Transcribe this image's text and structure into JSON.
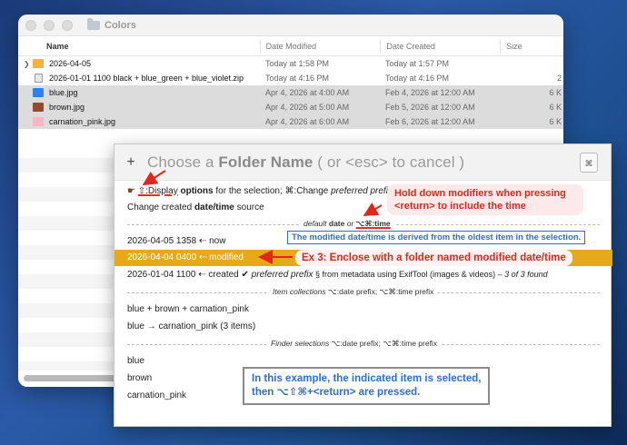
{
  "finder": {
    "title": "Colors",
    "columns": {
      "name": "Name",
      "modified": "Date Modified",
      "created": "Date Created",
      "size": "Size"
    },
    "rows": [
      {
        "name": "2026-04-05",
        "modified": "Today at 1:58 PM",
        "created": "Today at 1:57 PM",
        "size": "",
        "icon": "folder",
        "selected": false
      },
      {
        "name": "2026-01-01 1100 black + blue_green + blue_violet.zip",
        "modified": "Today at 4:16 PM",
        "created": "Today at 4:16 PM",
        "size": "2",
        "icon": "zip",
        "selected": false
      },
      {
        "name": "blue.jpg",
        "modified": "Apr 4, 2026 at 4:00 AM",
        "created": "Feb 4, 2026 at 12:00 AM",
        "size": "6 K",
        "icon": "blue",
        "selected": true
      },
      {
        "name": "brown.jpg",
        "modified": "Apr 4, 2026 at 5:00 AM",
        "created": "Feb 5, 2026 at 12:00 AM",
        "size": "6 K",
        "icon": "brown",
        "selected": true
      },
      {
        "name": "carnation_pink.jpg",
        "modified": "Apr 4, 2026 at 6:00 AM",
        "created": "Feb 6, 2026 at 12:00 AM",
        "size": "6 K",
        "icon": "pink",
        "selected": true
      }
    ]
  },
  "prompt": {
    "add_symbol": "+",
    "title_pre": "Choose a ",
    "title_bold": "Folder Name",
    "title_post": " ( or <esc> to cancel )",
    "icon_glyph": "⌘",
    "hint_modifier": "⇧:Display",
    "hint_options": "options",
    "hint_mid": " for the selection; ⌘:Change ",
    "hint_italic": "preferred prefix",
    "change_pre": "Change created ",
    "change_bold": "date/time",
    "change_post": " source",
    "sep_default": {
      "pre": "default ",
      "date": "date",
      "or": " or ",
      "time": "⌥⌘:time"
    },
    "opt_now": "2026-04-05 1358 ⇠ now",
    "opt_modified": "2026-04-04 0400 ⇠ modified",
    "opt_created_pre": "2026-01-04 1100 ⇠ created ",
    "opt_created_check": "✔",
    "opt_created_italic": " preferred prefix",
    "opt_created_post": " § from metadata using ExifTool (images & videos) – ",
    "opt_created_count": "3 of 3 found",
    "sep_items": {
      "label": "Item collections",
      "date": "⌥:date prefix; ⌥⌘:time prefix"
    },
    "coll_1": "blue + brown + carnation_pink",
    "coll_2": "blue → carnation_pink (3 items)",
    "sep_finder": {
      "label": "Finder selections",
      "date": "⌥:date prefix; ⌥⌘:time prefix"
    },
    "sel_1": "blue",
    "sel_2": "brown",
    "sel_3": "carnation_pink"
  },
  "annotations": {
    "hold_line1": "Hold down modifiers when pressing",
    "hold_line2": "<return> to include the time",
    "derived": "The modified date/time is derived from the oldest item in the selection.",
    "ex3": "Ex 3: Enclose with a folder named modified date/time",
    "example_line1": "In this example, the indicated item is selected,",
    "example_line2": "then ⌥⇧⌘+<return> are pressed."
  },
  "colors": {
    "highlight": "#e6a91a",
    "annotation_red": "#e2261c",
    "annotation_blue": "#2a6fd8"
  }
}
